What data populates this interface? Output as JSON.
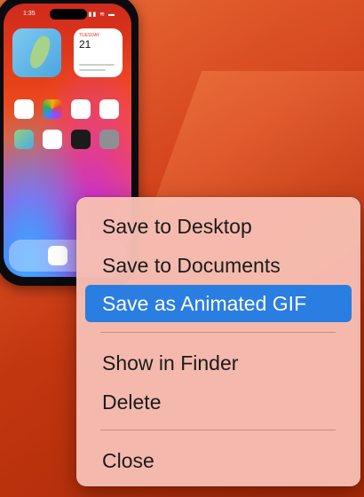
{
  "phone": {
    "status_time": "1:35",
    "status_icons": "▮▮ ≋ ▬",
    "widgets": {
      "calendar_day": "TUESDAY",
      "calendar_date": "21"
    },
    "apps": [
      {
        "name": "calendar-app-icon",
        "color": "#ffffff"
      },
      {
        "name": "photos-app-icon",
        "color": "#ffffff"
      },
      {
        "name": "reminders-app-icon",
        "color": "#ffffff"
      },
      {
        "name": "news-app-icon",
        "color": "#ffffff"
      },
      {
        "name": "maps-app-icon",
        "color": "#6fbf6a"
      },
      {
        "name": "health-app-icon",
        "color": "#ffffff"
      },
      {
        "name": "wallet-app-icon",
        "color": "#1b1b1b"
      },
      {
        "name": "settings-app-icon",
        "color": "#8e8e93"
      }
    ],
    "dock": [
      {
        "name": "safari-app-icon",
        "color": "#ffffff"
      }
    ]
  },
  "context_menu": {
    "items": [
      {
        "label": "Save to Desktop",
        "selected": false
      },
      {
        "label": "Save to Documents",
        "selected": false
      },
      {
        "label": "Save as Animated GIF",
        "selected": true
      },
      {
        "label": "Show in Finder",
        "selected": false
      },
      {
        "label": "Delete",
        "selected": false
      },
      {
        "label": "Close",
        "selected": false
      }
    ],
    "highlight_color": "#2a7de1"
  }
}
